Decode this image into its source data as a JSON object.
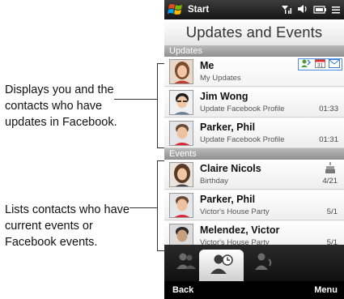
{
  "annotations": {
    "updates_caption": "Displays you and the contacts who have updates in Facebook.",
    "events_caption": "Lists contacts who have current events or Facebook events."
  },
  "statusbar": {
    "start_label": "Start",
    "icons": [
      "windows-logo-icon",
      "signal-icon",
      "volume-icon",
      "battery-icon",
      "connectivity-icon"
    ]
  },
  "title": "Updates and Events",
  "sections": {
    "updates_label": "Updates",
    "events_label": "Events"
  },
  "updates": [
    {
      "name": "Me",
      "detail": "My Updates",
      "time": ""
    },
    {
      "name": "Jim Wong",
      "detail": "Update Facebook Profile",
      "time": "01:33"
    },
    {
      "name": "Parker, Phil",
      "detail": "Update Facebook Profile",
      "time": "01:31"
    }
  ],
  "update_icons": [
    "people-update-icon",
    "calendar-icon",
    "email-icon"
  ],
  "events": [
    {
      "name": "Claire Nicols",
      "detail": "Birthday",
      "date": "4/21"
    },
    {
      "name": "Parker, Phil",
      "detail": "Victor's House Party",
      "date": "5/1"
    },
    {
      "name": "Melendez, Victor",
      "detail": "Victor's House Party",
      "date": "5/1"
    }
  ],
  "tabs": [
    "people-tab",
    "updates-events-tab",
    "contact-tab"
  ],
  "softkeys": {
    "left": "Back",
    "right": "Menu"
  },
  "colors": {
    "accent_blue": "#4a90e2",
    "section_header": "#9a9a9a",
    "status_bar": "#1c1c1c"
  }
}
